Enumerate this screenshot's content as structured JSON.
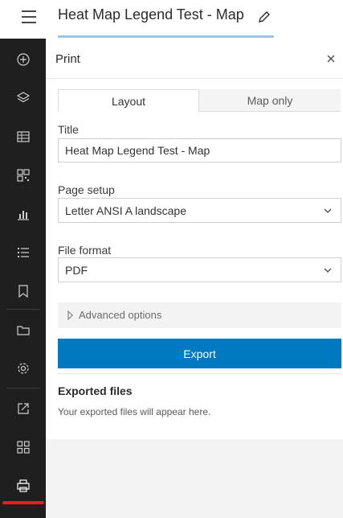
{
  "header": {
    "title": "Heat Map Legend Test - Map"
  },
  "rail": {
    "items": [
      "add-icon",
      "layers-icon",
      "table-icon",
      "qr-grid-icon",
      "bar-chart-icon",
      "list-icon",
      "bookmark-icon",
      "folder-icon",
      "settings-icon",
      "share-icon",
      "apps-icon",
      "print-icon"
    ],
    "active_color": "#e01f26"
  },
  "panel": {
    "title": "Print",
    "tabs": [
      {
        "label": "Layout"
      },
      {
        "label": "Map only"
      }
    ],
    "title_field": {
      "label": "Title",
      "value": "Heat Map Legend Test - Map"
    },
    "page_setup": {
      "label": "Page setup",
      "value": "Letter ANSI A landscape"
    },
    "file_format": {
      "label": "File format",
      "value": "PDF"
    },
    "advanced_label": "Advanced options",
    "export_label": "Export",
    "exported_title": "Exported files",
    "exported_note": "Your exported files will appear here."
  },
  "colors": {
    "accent": "#0079c1",
    "rail_bg": "#1f1f1f"
  }
}
